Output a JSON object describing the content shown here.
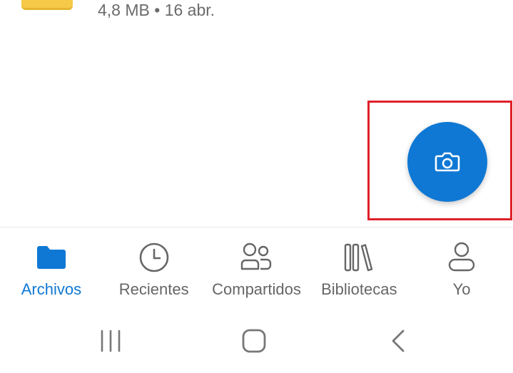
{
  "list": {
    "partial_row": {
      "meta": "4,8 MB • 16 abr."
    }
  },
  "fab": {
    "icon": "camera-icon",
    "color": "#0f78d4"
  },
  "highlight": {
    "color": "#e0202a"
  },
  "bottom_nav": {
    "items": [
      {
        "label": "Archivos",
        "icon": "folder-icon",
        "active": true
      },
      {
        "label": "Recientes",
        "icon": "clock-icon",
        "active": false
      },
      {
        "label": "Compartidos",
        "icon": "people-icon",
        "active": false
      },
      {
        "label": "Bibliotecas",
        "icon": "library-icon",
        "active": false
      },
      {
        "label": "Yo",
        "icon": "person-icon",
        "active": false
      }
    ],
    "active_color": "#0f78d4",
    "inactive_color": "#666666"
  },
  "system_bar": {
    "buttons": [
      "recents-icon",
      "home-icon",
      "back-icon"
    ]
  }
}
